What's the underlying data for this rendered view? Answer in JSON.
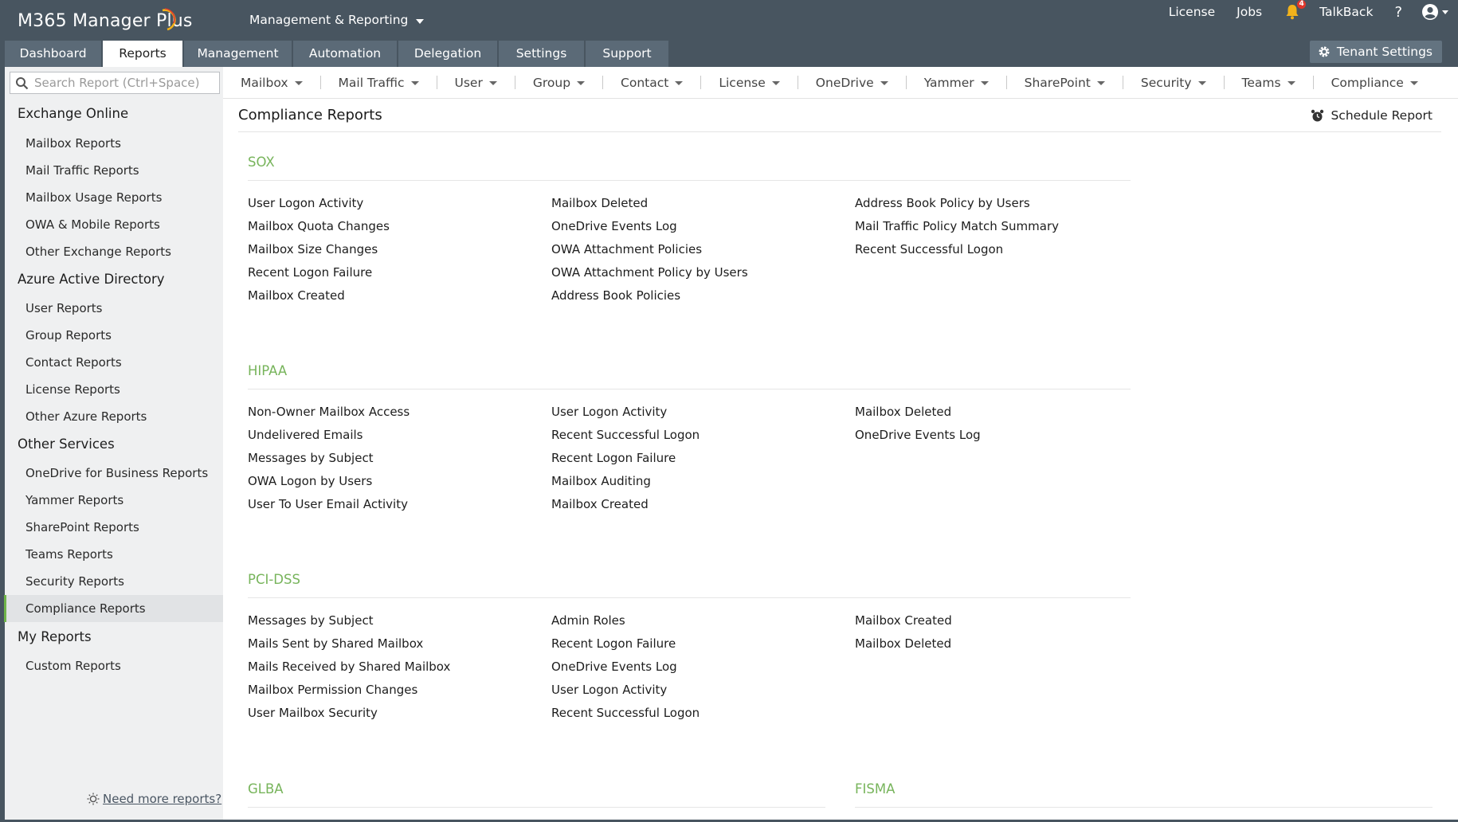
{
  "header": {
    "app_name": "M365 Manager Plus",
    "module_switch": "Management & Reporting",
    "links": {
      "license": "License",
      "jobs": "Jobs",
      "talkback": "TalkBack",
      "help": "?"
    },
    "notification_count": "4",
    "tenant_settings": "Tenant Settings"
  },
  "main_tabs": [
    "Dashboard",
    "Reports",
    "Management",
    "Automation",
    "Delegation",
    "Settings",
    "Support"
  ],
  "active_tab": "Reports",
  "search": {
    "placeholder": "Search Report (Ctrl+Space)"
  },
  "sidebar": {
    "groups": [
      {
        "title": "Exchange Online",
        "items": [
          "Mailbox Reports",
          "Mail Traffic Reports",
          "Mailbox Usage Reports",
          "OWA & Mobile Reports",
          "Other Exchange Reports"
        ]
      },
      {
        "title": "Azure Active Directory",
        "items": [
          "User Reports",
          "Group Reports",
          "Contact Reports",
          "License Reports",
          "Other Azure Reports"
        ]
      },
      {
        "title": "Other Services",
        "items": [
          "OneDrive for Business Reports",
          "Yammer Reports",
          "SharePoint Reports",
          "Teams Reports",
          "Security Reports",
          "Compliance Reports"
        ]
      },
      {
        "title": "My Reports",
        "items": [
          "Custom Reports"
        ]
      }
    ],
    "active_item": "Compliance Reports",
    "need_more": "Need more reports?"
  },
  "categories": [
    "Mailbox",
    "Mail Traffic",
    "User",
    "Group",
    "Contact",
    "License",
    "OneDrive",
    "Yammer",
    "SharePoint",
    "Security",
    "Teams",
    "Compliance"
  ],
  "page": {
    "title": "Compliance Reports",
    "schedule": "Schedule Report"
  },
  "sections": [
    {
      "title": "SOX",
      "columns": [
        [
          "User Logon Activity",
          "Mailbox Quota Changes",
          "Mailbox Size Changes",
          "Recent Logon Failure",
          "Mailbox Created"
        ],
        [
          "Mailbox Deleted",
          "OneDrive Events Log",
          "OWA Attachment Policies",
          "OWA Attachment Policy by Users",
          "Address Book Policies"
        ],
        [
          "Address Book Policy by Users",
          "Mail Traffic Policy Match Summary",
          "Recent Successful Logon"
        ]
      ]
    },
    {
      "title": "HIPAA",
      "columns": [
        [
          "Non-Owner Mailbox Access",
          "Undelivered Emails",
          "Messages by Subject",
          "OWA Logon by Users",
          "User To User Email Activity"
        ],
        [
          "User Logon Activity",
          "Recent Successful Logon",
          "Recent Logon Failure",
          "Mailbox Auditing",
          "Mailbox Created"
        ],
        [
          "Mailbox Deleted",
          "OneDrive Events Log"
        ]
      ]
    },
    {
      "title": "PCI-DSS",
      "columns": [
        [
          "Messages by Subject",
          "Mails Sent by Shared Mailbox",
          "Mails Received by Shared Mailbox",
          "Mailbox Permission Changes",
          "User Mailbox Security"
        ],
        [
          "Admin Roles",
          "Recent Logon Failure",
          "OneDrive Events Log",
          "User Logon Activity",
          "Recent Successful Logon"
        ],
        [
          "Mailbox Created",
          "Mailbox Deleted"
        ]
      ]
    },
    {
      "title": "GLBA",
      "columns": []
    },
    {
      "title": "FISMA",
      "columns": []
    }
  ],
  "colors": {
    "header": "#485560",
    "tab": "#5b6a77",
    "accent_green": "#77b45b",
    "sidebar_bg": "#eff0f1"
  }
}
